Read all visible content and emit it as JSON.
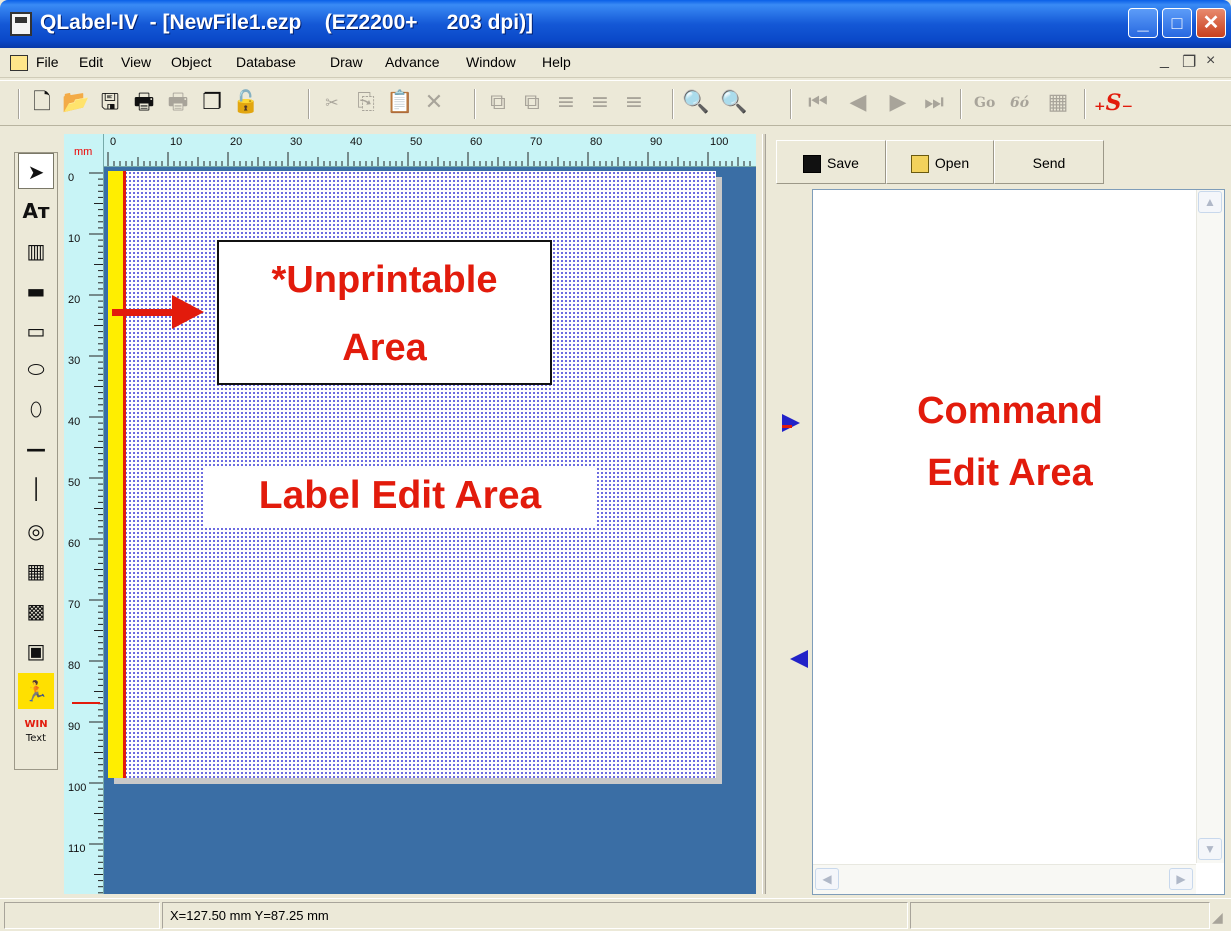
{
  "window": {
    "title": "QLabel-IV  - [NewFile1.ezp    (EZ2200+     203 dpi)]",
    "minimize_label": "_",
    "maximize_label": "□",
    "close_label": "✕"
  },
  "menu": {
    "items": [
      "File",
      "Edit",
      "View",
      "Object",
      "Database",
      "Draw",
      "Advance",
      "Window",
      "Help"
    ],
    "mdi_min": "_",
    "mdi_restore": "❐",
    "mdi_close": "×"
  },
  "toolbar": {
    "go_label": "Go",
    "glasses_label": "6ó"
  },
  "palette": {
    "text_tool": "Aᴛ",
    "wintext_top": "WIN",
    "wintext_bottom": "Text"
  },
  "ruler": {
    "unit": "mm",
    "top_labels": [
      "0",
      "10",
      "20",
      "30",
      "40",
      "50",
      "60",
      "70",
      "80",
      "90",
      "100"
    ],
    "left_labels": [
      "0",
      "10",
      "20",
      "30",
      "40",
      "50",
      "60",
      "70",
      "80",
      "90",
      "100",
      "110"
    ]
  },
  "canvas": {
    "unprintable_label": "*Unprintable Area",
    "label_edit_label": "Label Edit Area"
  },
  "command_panel": {
    "save_label": "Save",
    "open_label": "Open",
    "send_label": "Send",
    "title": "Command Edit Area"
  },
  "status": {
    "coords": "X=127.50 mm  Y=87.25 mm"
  },
  "colors": {
    "accent_red": "#e21b0c",
    "unprintable_yellow": "#ffee00",
    "workspace_blue": "#3a6ea5",
    "ruler_cyan": "#c8f4f6"
  }
}
